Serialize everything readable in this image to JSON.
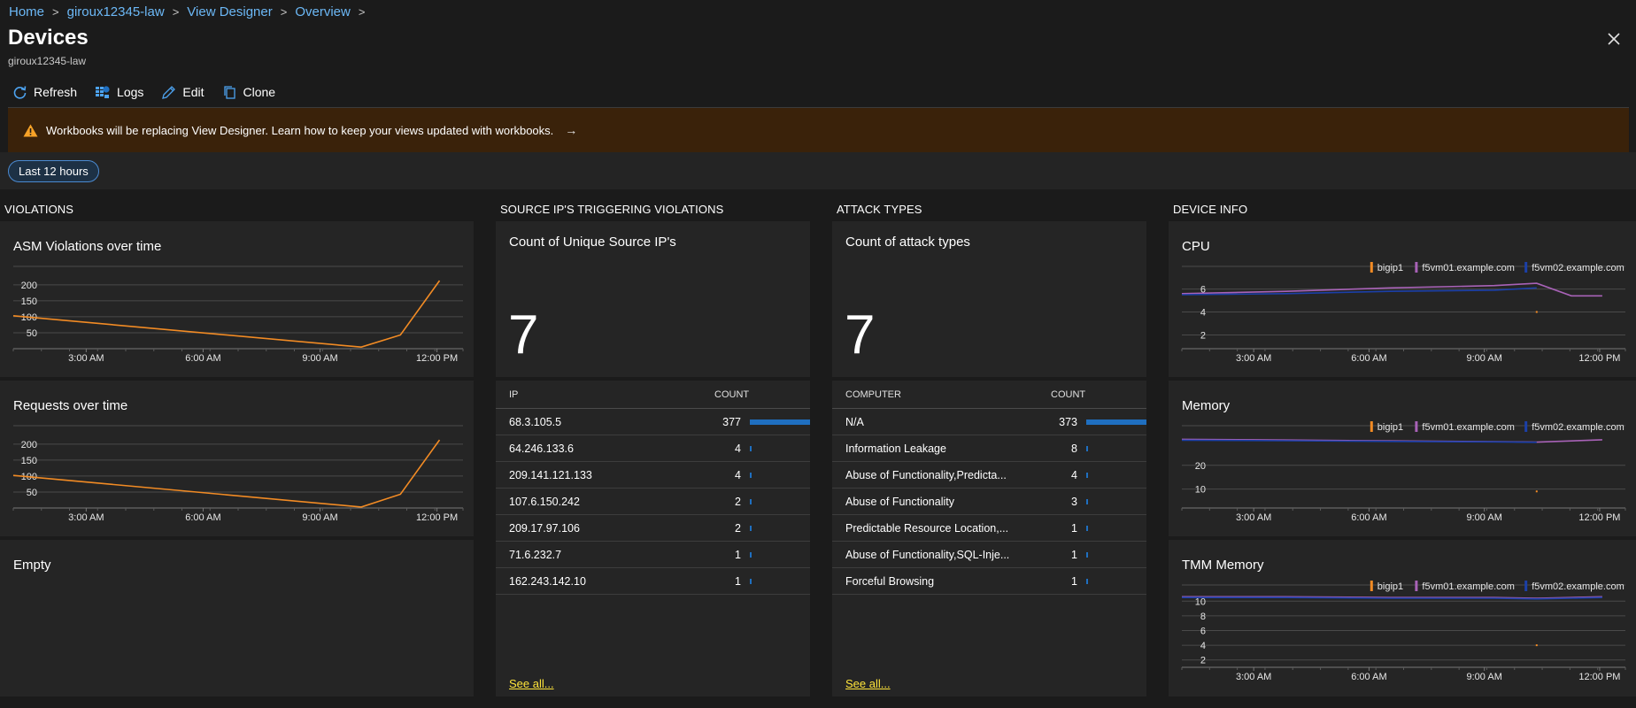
{
  "breadcrumb": [
    "Home",
    "giroux12345-law",
    "View Designer",
    "Overview"
  ],
  "page": {
    "title": "Devices",
    "subtitle": "giroux12345-law"
  },
  "toolbar": {
    "refresh": "Refresh",
    "logs": "Logs",
    "edit": "Edit",
    "clone": "Clone"
  },
  "banner": {
    "text": "Workbooks will be replacing View Designer. Learn how to keep your views updated with workbooks.",
    "arrow": "→"
  },
  "filter": {
    "time_range": "Last 12 hours"
  },
  "sections": {
    "violations": "VIOLATIONS",
    "source_ips": "SOURCE IP'S TRIGGERING VIOLATIONS",
    "attack_types": "ATTACK TYPES",
    "device_info": "DEVICE INFO"
  },
  "panels": {
    "asm_title": "ASM Violations over time",
    "requests_title": "Requests over time",
    "empty_title": "Empty",
    "unique_ips_title": "Count of Unique Source IP's",
    "unique_ips_count": "7",
    "attack_types_title": "Count of attack types",
    "attack_types_count": "7",
    "cpu_title": "CPU",
    "memory_title": "Memory",
    "tmm_title": "TMM Memory"
  },
  "ip_table": {
    "headers": [
      "IP",
      "COUNT"
    ],
    "rows": [
      {
        "label": "68.3.105.5",
        "count": "377",
        "value": 377
      },
      {
        "label": "64.246.133.6",
        "count": "4",
        "value": 4
      },
      {
        "label": "209.141.121.133",
        "count": "4",
        "value": 4
      },
      {
        "label": "107.6.150.242",
        "count": "2",
        "value": 2
      },
      {
        "label": "209.17.97.106",
        "count": "2",
        "value": 2
      },
      {
        "label": "71.6.232.7",
        "count": "1",
        "value": 1
      },
      {
        "label": "162.243.142.10",
        "count": "1",
        "value": 1
      }
    ],
    "see_all": "See all..."
  },
  "attack_table": {
    "headers": [
      "COMPUTER",
      "COUNT"
    ],
    "rows": [
      {
        "label": "N/A",
        "count": "373",
        "value": 373
      },
      {
        "label": "Information Leakage",
        "count": "8",
        "value": 8
      },
      {
        "label": "Abuse of Functionality,Predicta...",
        "count": "4",
        "value": 4
      },
      {
        "label": "Abuse of Functionality",
        "count": "3",
        "value": 3
      },
      {
        "label": "Predictable Resource Location,...",
        "count": "1",
        "value": 1
      },
      {
        "label": "Abuse of Functionality,SQL-Inje...",
        "count": "1",
        "value": 1
      },
      {
        "label": "Forceful Browsing",
        "count": "1",
        "value": 1
      }
    ],
    "see_all": "See all..."
  },
  "colors": {
    "bigip1": "#f28b24",
    "f5vm01": "#a862b7",
    "f5vm02": "#1b3fa8",
    "bar": "#1f6fc0"
  },
  "chart_data": [
    {
      "type": "line",
      "name": "ASM Violations over time",
      "x_ticks": [
        "3:00 AM",
        "6:00 AM",
        "9:00 AM",
        "12:00 PM"
      ],
      "y_ticks": [
        50,
        100,
        150,
        200
      ],
      "ylim": [
        0,
        230
      ],
      "x_range": [
        1.5,
        13.0
      ],
      "series": [
        {
          "name": "",
          "x": [
            1.5,
            10.4,
            11.4,
            12.4
          ],
          "y": [
            103,
            5,
            43,
            213
          ]
        }
      ]
    },
    {
      "type": "line",
      "name": "Requests over time",
      "x_ticks": [
        "3:00 AM",
        "6:00 AM",
        "9:00 AM",
        "12:00 PM"
      ],
      "y_ticks": [
        50,
        100,
        150,
        200
      ],
      "ylim": [
        0,
        230
      ],
      "x_range": [
        1.5,
        13.0
      ],
      "series": [
        {
          "name": "",
          "x": [
            1.5,
            10.4,
            11.4,
            12.4
          ],
          "y": [
            102,
            3,
            43,
            213
          ]
        }
      ]
    },
    {
      "type": "line",
      "name": "CPU",
      "legend": [
        "bigip1",
        "f5vm01.example.com",
        "f5vm02.example.com"
      ],
      "x_ticks": [
        "3:00 AM",
        "6:00 AM",
        "9:00 AM",
        "12:00 PM"
      ],
      "y_ticks": [
        2,
        4,
        6
      ],
      "ylim": [
        0.8,
        7.2
      ],
      "x_range": [
        1.5,
        13.0
      ],
      "series": [
        {
          "name": "bigip1",
          "x": [
            10.7
          ],
          "y": [
            4.0
          ]
        },
        {
          "name": "f5vm01.example.com",
          "x": [
            1.5,
            4.2,
            6.9,
            9.6,
            10.7,
            11.6,
            12.4
          ],
          "y": [
            5.6,
            5.8,
            6.1,
            6.3,
            6.5,
            5.4,
            5.4
          ]
        },
        {
          "name": "f5vm02.example.com",
          "x": [
            1.5,
            4.2,
            6.9,
            9.6,
            10.7
          ],
          "y": [
            5.5,
            5.6,
            5.8,
            5.9,
            6.1
          ]
        }
      ]
    },
    {
      "type": "line",
      "name": "Memory",
      "legend": [
        "bigip1",
        "f5vm01.example.com",
        "f5vm02.example.com"
      ],
      "x_ticks": [
        "3:00 AM",
        "6:00 AM",
        "9:00 AM",
        "12:00 PM"
      ],
      "y_ticks": [
        10,
        20
      ],
      "ylim": [
        2,
        33
      ],
      "x_range": [
        1.5,
        13.0
      ],
      "series": [
        {
          "name": "bigip1",
          "x": [
            10.7
          ],
          "y": [
            9.0
          ]
        },
        {
          "name": "f5vm01.example.com",
          "x": [
            1.5,
            4.2,
            6.9,
            9.6,
            10.7,
            12.4
          ],
          "y": [
            31.0,
            30.7,
            30.3,
            30.0,
            29.8,
            30.8
          ]
        },
        {
          "name": "f5vm02.example.com",
          "x": [
            1.5,
            4.2,
            6.9,
            9.6,
            10.7
          ],
          "y": [
            30.6,
            30.4,
            30.1,
            29.9,
            29.7
          ]
        }
      ]
    },
    {
      "type": "line",
      "name": "TMM Memory",
      "legend": [
        "bigip1",
        "f5vm01.example.com",
        "f5vm02.example.com"
      ],
      "x_ticks": [
        "3:00 AM",
        "6:00 AM",
        "9:00 AM",
        "12:00 PM"
      ],
      "y_ticks": [
        2,
        4,
        6,
        8,
        10
      ],
      "ylim": [
        1.0,
        11.0
      ],
      "x_range": [
        1.5,
        13.0
      ],
      "series": [
        {
          "name": "bigip1",
          "x": [
            10.7
          ],
          "y": [
            4.0
          ]
        },
        {
          "name": "f5vm01.example.com",
          "x": [
            1.5,
            4.2,
            6.9,
            9.6,
            10.7,
            12.4
          ],
          "y": [
            10.6,
            10.6,
            10.5,
            10.5,
            10.4,
            10.6
          ]
        },
        {
          "name": "f5vm02.example.com",
          "x": [
            1.5,
            4.2,
            6.9,
            9.6,
            10.7,
            12.4
          ],
          "y": [
            10.5,
            10.5,
            10.4,
            10.4,
            10.3,
            10.5
          ]
        }
      ]
    }
  ]
}
